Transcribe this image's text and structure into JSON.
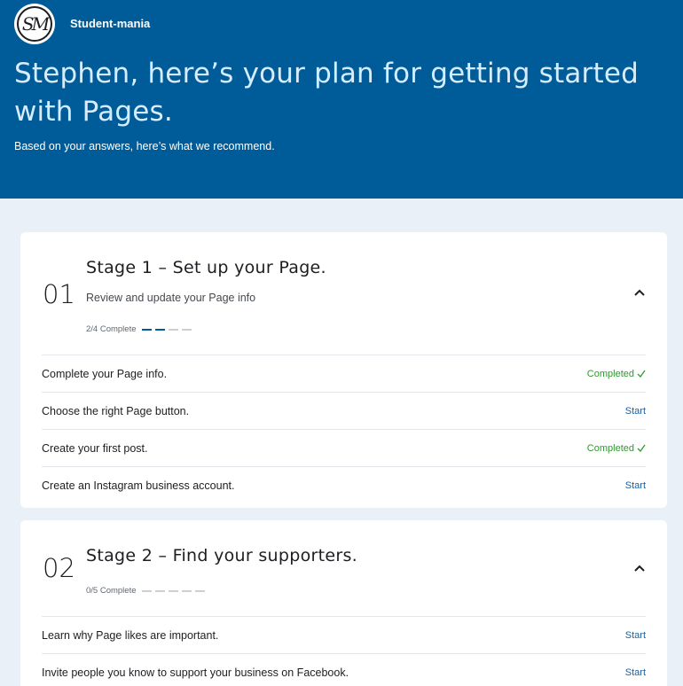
{
  "header": {
    "logo_text": "SM",
    "page_name": "Student-mania",
    "title": "Stephen, here’s your plan for getting started with Pages.",
    "subtitle": "Based on your answers, here’s what we recommend."
  },
  "stages": [
    {
      "number": "01",
      "title": "Stage 1 – Set up your Page.",
      "description": "Review and update your Page info",
      "progress_text": "2/4 Complete",
      "progress": {
        "done": 2,
        "total": 4
      },
      "tasks": [
        {
          "label": "Complete your Page info.",
          "action": "Completed",
          "status": "completed"
        },
        {
          "label": "Choose the right Page button.",
          "action": "Start",
          "status": "start"
        },
        {
          "label": "Create your first post.",
          "action": "Completed",
          "status": "completed"
        },
        {
          "label": "Create an Instagram business account.",
          "action": "Start",
          "status": "start"
        }
      ]
    },
    {
      "number": "02",
      "title": "Stage 2 – Find your supporters.",
      "progress_text": "0/5 Complete",
      "progress": {
        "done": 0,
        "total": 5
      },
      "tasks": [
        {
          "label": "Learn why Page likes are important.",
          "action": "Start",
          "status": "start"
        },
        {
          "label": "Invite people you know to support your business on Facebook.",
          "action": "Start",
          "status": "start"
        }
      ]
    }
  ],
  "icons": {
    "collapse": "chevron-up-icon",
    "completed": "check-icon"
  },
  "colors": {
    "header_bg": "#005c99",
    "page_bg": "#e9f0f8",
    "completed": "#2e9a2e",
    "start_link": "#1d5f9e"
  }
}
